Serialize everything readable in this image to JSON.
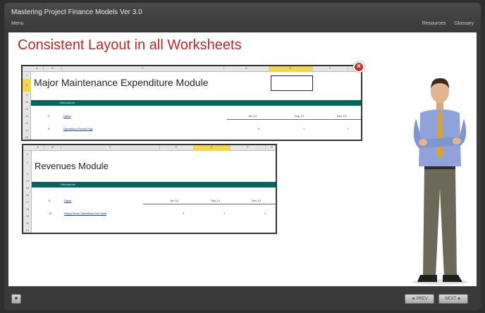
{
  "header": {
    "course_title": "Mastering Project Finance Models Ver 3.0",
    "menu_label": "Menu",
    "resources_label": "Resources",
    "glossary_label": "Glossary"
  },
  "slide": {
    "title": "Consistent Layout in all Worksheets"
  },
  "sheet1": {
    "title": "Major Maintenance Expenditure Module",
    "columns": [
      "A",
      "B",
      "C",
      "D",
      "E",
      "F",
      "G"
    ],
    "rows": [
      "1",
      "2",
      "3",
      "10",
      "11",
      "12",
      "13",
      "14",
      "15"
    ],
    "band_label": "Calculations",
    "row_a": {
      "num": "9",
      "label": "Dates",
      "v1": "Jun-14",
      "v2": "Sep-14",
      "v3": "Dec-14"
    },
    "row_b": {
      "num": "9",
      "label": "Operations Period Flag",
      "v1": "0",
      "v2": "1",
      "v3": "1"
    }
  },
  "sheet2": {
    "title": "Revenues Module",
    "columns": [
      "A",
      "B",
      "C",
      "D",
      "E",
      "F",
      "G"
    ],
    "rows": [
      "1",
      "2",
      "3",
      "14",
      "15",
      "16",
      "17",
      "18",
      "19",
      "20",
      "21"
    ],
    "band_label": "Calculations",
    "row_a": {
      "num": "9",
      "label": "Dates",
      "v1": "Jun-14",
      "v2": "Sep-14",
      "v3": "Dec-14"
    },
    "row_b": {
      "num": "10",
      "label": "Flag (Check Operations End Date",
      "v1": "0",
      "v2": "1",
      "v3": "1"
    }
  },
  "footer": {
    "menu_icon": "menu-icon",
    "prev_label": "◄ PREV",
    "next_label": "NEXT ►"
  },
  "colors": {
    "title_red": "#b32a2a",
    "band_teal": "#00665e",
    "selected_yellow": "#f3d54e",
    "close_red": "#c9302c"
  }
}
